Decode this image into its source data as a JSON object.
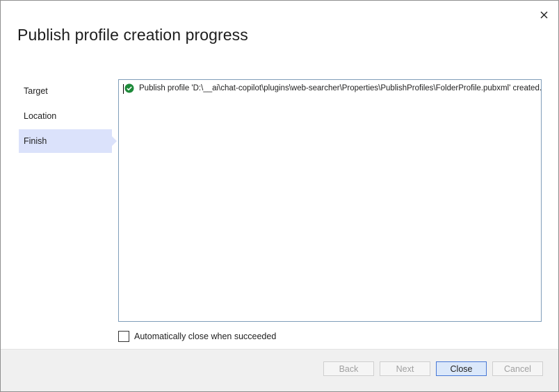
{
  "dialog": {
    "title": "Publish profile creation progress",
    "close_icon": "close-icon"
  },
  "steps": [
    {
      "label": "Target",
      "active": false
    },
    {
      "label": "Location",
      "active": false
    },
    {
      "label": "Finish",
      "active": true
    }
  ],
  "log": {
    "status_icon": "check-circle-icon",
    "status_color": "#1e8a3a",
    "message": "Publish profile 'D:\\__ai\\chat-copilot\\plugins\\web-searcher\\Properties\\PublishProfiles\\FolderProfile.pubxml' created."
  },
  "auto_close": {
    "label": "Automatically close when succeeded",
    "checked": false
  },
  "buttons": {
    "back": "Back",
    "next": "Next",
    "close": "Close",
    "cancel": "Cancel"
  },
  "colors": {
    "accent": "#4677d6",
    "active_step_bg": "#dbe2fb"
  }
}
